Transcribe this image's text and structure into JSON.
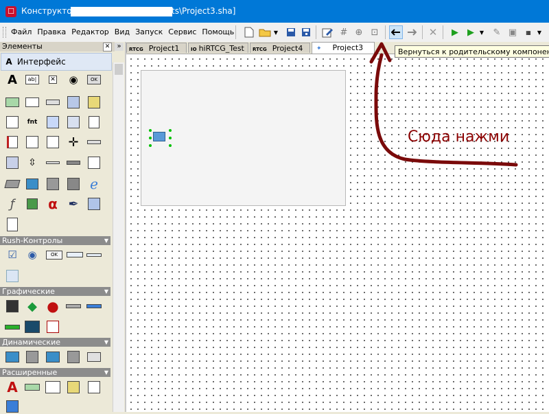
{
  "window": {
    "title_prefix": "Конструктор [",
    "title_file": "ts\\Project3.sha]"
  },
  "menu": {
    "items": [
      "Файл",
      "Правка",
      "Редактор",
      "Вид",
      "Запуск",
      "Сервис",
      "Помощь"
    ]
  },
  "palette": {
    "title": "Элементы",
    "categories": [
      {
        "label": "Интерфейс"
      },
      {
        "label": "Rush-Контролы"
      },
      {
        "label": "Графические"
      },
      {
        "label": "Динамические"
      },
      {
        "label": "Расширенные"
      }
    ],
    "icon_text": {
      "text": "A",
      "edit": "ab|",
      "check": "✕",
      "radio": "◉",
      "ok": "OK",
      "font": "fnt",
      "alpha": "α",
      "ok2": "OK"
    }
  },
  "tabs": [
    {
      "label": "Project1",
      "icon": "RTCG"
    },
    {
      "label": "hiRTCG_Test",
      "icon": "IO"
    },
    {
      "label": "Project4",
      "icon": "RTCG"
    },
    {
      "label": "Project3",
      "icon": "✦",
      "active": true
    }
  ],
  "tooltip": {
    "text": "Вернуться к родительскому компоненту"
  },
  "annotation": {
    "text": "Сюда нажми"
  },
  "colors": {
    "titlebar": "#0078d7",
    "annotation": "#8b0000",
    "tooltip_bg": "#ffffe1"
  }
}
